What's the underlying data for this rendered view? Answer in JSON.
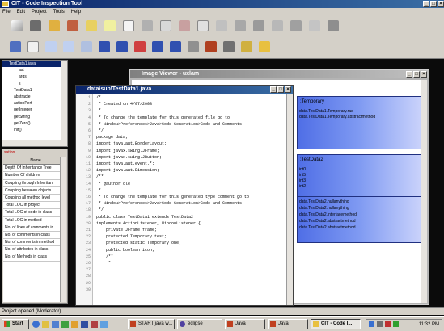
{
  "app": {
    "title": "CIT - Code Inspection Tool"
  },
  "menu": [
    "File",
    "Edit",
    "Project",
    "Tools",
    "Help"
  ],
  "tree": {
    "root": "TestData1.java",
    "items": [
      "ast",
      "args",
      "s",
      "TestData1",
      "abstracte",
      "actionPerf",
      "getInteger",
      "getString",
      "getZero()",
      "init()"
    ]
  },
  "metrics": {
    "tab": "sation",
    "header": "Name",
    "rows": [
      "Depth Of Inheritance Tree",
      "Number Of children",
      "Coupling through Inheritan",
      "Coupling between objects",
      "Coupling all method level",
      "Total LOC in project",
      "Total LOC of code in class",
      "Total LOC in method",
      "No. of lines of comments in",
      "No. of comments in class",
      "No. of comments in method",
      "No. of attributes in class",
      "No. of Methods in class"
    ]
  },
  "status": {
    "text": "Project opened (Moderator)"
  },
  "editor": {
    "title": "data\\sub\\TestData1.java",
    "lines": [
      "/*",
      " * Created on 4/07/2003",
      " *",
      " * To change the template for this generated file go to",
      " * Window>Preferences>Java>Code Generation>Code and Comments",
      " */",
      "package data;",
      "",
      "import java.awt.BorderLayout;",
      "import javax.swing.JFrame;",
      "import javax.swing.JButton;",
      "import java.awt.event.*;",
      "import java.awt.Dimension;",
      "",
      "/**",
      " * @author cle",
      " *",
      " * To change the template for this generated type comment go to",
      " * Window>Preferences>Java>Code Generation>Code and Comments",
      " */",
      "public class TestData1 extends TestData2",
      "implements ActionListener, WindowListener {",
      "",
      "    private JFrame frame;",
      "    protected Temporary test;",
      "    protected static Temporary one;",
      "    public boolean icon;",
      "",
      "    /**",
      "     *"
    ]
  },
  "image_viewer": {
    "title": "Image Viewer - uxlam",
    "box1": {
      "title": ":Temporary",
      "lines": [
        "data.TestData1.Temporary.rad",
        "data.TestData1.Temporary.abstractmethod"
      ]
    },
    "box2": {
      "title": ":TestData2",
      "fields": [
        "int0",
        "int5",
        "int3",
        "int2"
      ],
      "methods": [
        "data.TestData2.nullanything",
        "data.TestData2.nullanything",
        "data.TestData2.interfacemethod",
        "data.TestData2.abstractmethod",
        "data.TestData2.abstractmethod"
      ]
    }
  },
  "taskbar": {
    "start": "Start",
    "buttons": [
      "START java w...",
      "eclipse",
      "Java",
      "Java",
      "CIT - Code I..."
    ],
    "clock": "11:32 PM"
  },
  "colors": {
    "titlebar": "#0a246a",
    "chrome": "#d4d0c8",
    "uml_blue": "#4f6ee6"
  }
}
